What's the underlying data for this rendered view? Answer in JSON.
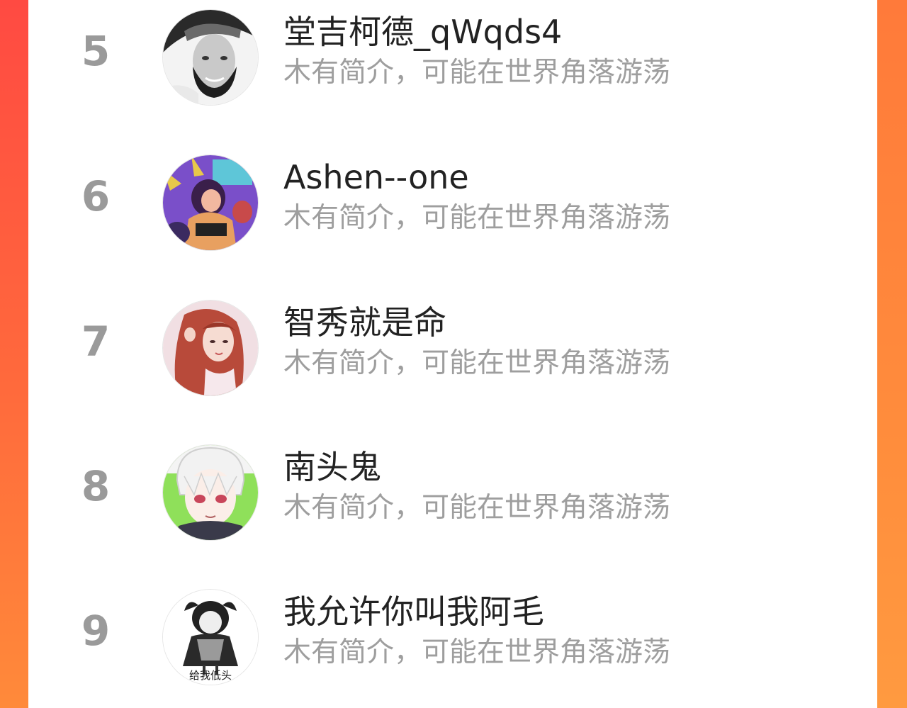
{
  "colors": {
    "background_gradient_top": "#ff4a42",
    "background_gradient_bottom": "#ff8a3a",
    "panel": "#ffffff",
    "rank_text": "#9a9a9a",
    "name_text": "#222222",
    "desc_text": "#9e9e9e"
  },
  "users": [
    {
      "rank": "5",
      "name": "堂吉柯德_qWqds4",
      "desc": "木有简介，可能在世界角落游荡",
      "avatar_icon": "bearded-man-photo-avatar"
    },
    {
      "rank": "6",
      "name": "Ashen--one",
      "desc": "木有简介，可能在世界角落游荡",
      "avatar_icon": "purple-cartoon-singer-avatar"
    },
    {
      "rank": "7",
      "name": "智秀就是命",
      "desc": "木有简介，可能在世界角落游荡",
      "avatar_icon": "red-haired-woman-photo-avatar"
    },
    {
      "rank": "8",
      "name": "南头鬼",
      "desc": "木有简介，可能在世界角落游荡",
      "avatar_icon": "white-haired-anime-boy-avatar"
    },
    {
      "rank": "9",
      "name": "我允许你叫我阿毛",
      "desc": "木有简介，可能在世界角落游荡",
      "avatar_icon": "gothic-girl-sketch-avatar",
      "avatar_caption": "给我低头"
    }
  ]
}
